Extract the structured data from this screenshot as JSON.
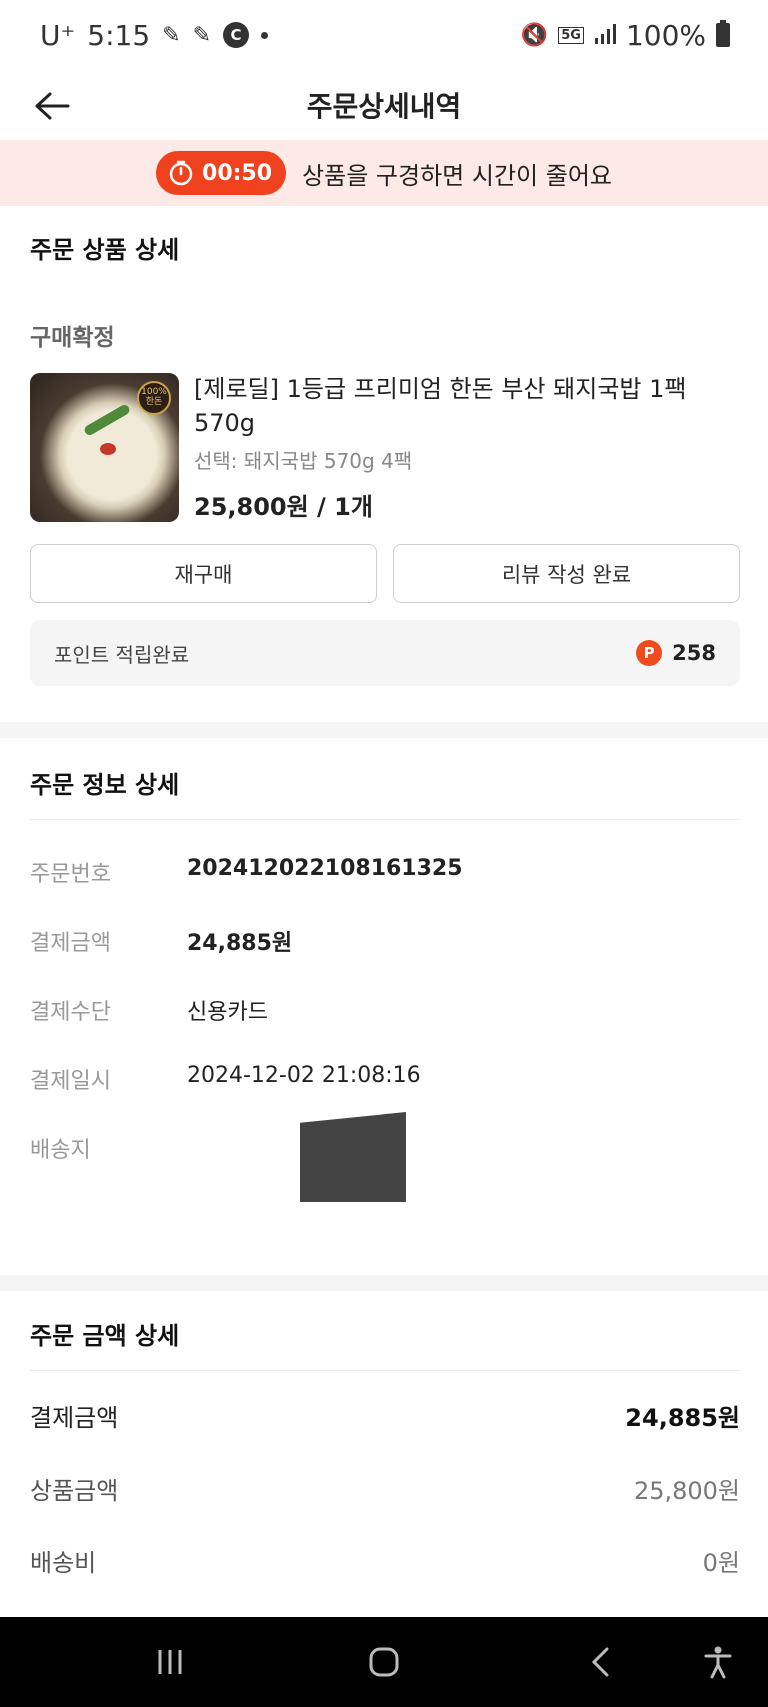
{
  "status_bar": {
    "carrier": "U⁺",
    "time": "5:15",
    "network": "5G",
    "battery": "100%"
  },
  "header": {
    "title": "주문상세내역"
  },
  "timer_banner": {
    "countdown": "00:50",
    "message": "상품을 구경하면 시간이 줄어요"
  },
  "product_section": {
    "title": "주문 상품 상세",
    "status": "구매확정",
    "product": {
      "name": "[제로딜] 1등급 프리미엄 한돈 부산 돼지국밥 1팩 570g",
      "option": "선택: 돼지국밥 570g 4팩",
      "price_qty": "25,800원 / 1개",
      "badge": "100% 한돈"
    },
    "buttons": {
      "rebuy": "재구매",
      "review": "리뷰 작성 완료"
    },
    "points": {
      "label": "포인트 적립완료",
      "icon_letter": "P",
      "value": "258"
    }
  },
  "order_info": {
    "title": "주문 정보 상세",
    "rows": [
      {
        "label": "주문번호",
        "value": "20241202210816132​5"
      },
      {
        "label": "결제금액",
        "value": "24,885원"
      },
      {
        "label": "결제수단",
        "value": "신용카드"
      },
      {
        "label": "결제일시",
        "value": "2024-12-02 21:08:16"
      },
      {
        "label": "배송지",
        "value": ""
      }
    ]
  },
  "amount_detail": {
    "title": "주문 금액 상세",
    "rows": [
      {
        "label": "결제금액",
        "value": "24,885원"
      },
      {
        "label": "상품금액",
        "value": "25,800원"
      },
      {
        "label": "배송비",
        "value": "0원"
      }
    ]
  },
  "colors": {
    "accent": "#f0421e",
    "banner_bg": "#fde9e6",
    "nav_bg": "#000000"
  }
}
